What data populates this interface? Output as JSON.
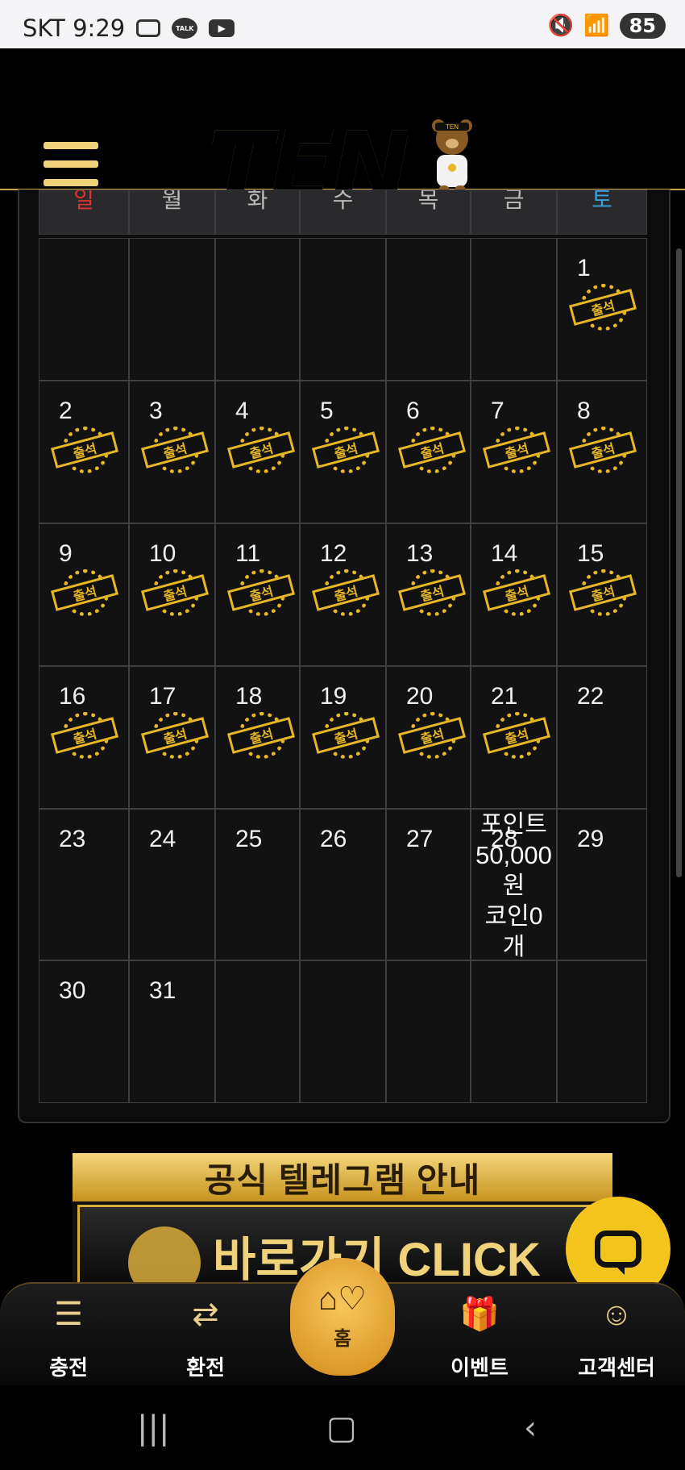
{
  "status_bar": {
    "carrier_time": "SKT 9:29",
    "battery": "85"
  },
  "header": {
    "logo_text": "TEN",
    "bear_badge": "TEN"
  },
  "calendar": {
    "weekdays": [
      "일",
      "월",
      "화",
      "수",
      "목",
      "금",
      "토"
    ],
    "stamp_label": "출석",
    "weeks": [
      [
        {
          "d": ""
        },
        {
          "d": ""
        },
        {
          "d": ""
        },
        {
          "d": ""
        },
        {
          "d": ""
        },
        {
          "d": ""
        },
        {
          "d": "1",
          "stamp": true
        }
      ],
      [
        {
          "d": "2",
          "stamp": true
        },
        {
          "d": "3",
          "stamp": true
        },
        {
          "d": "4",
          "stamp": true
        },
        {
          "d": "5",
          "stamp": true
        },
        {
          "d": "6",
          "stamp": true
        },
        {
          "d": "7",
          "stamp": true
        },
        {
          "d": "8",
          "stamp": true
        }
      ],
      [
        {
          "d": "9",
          "stamp": true
        },
        {
          "d": "10",
          "stamp": true
        },
        {
          "d": "11",
          "stamp": true
        },
        {
          "d": "12",
          "stamp": true
        },
        {
          "d": "13",
          "stamp": true
        },
        {
          "d": "14",
          "stamp": true
        },
        {
          "d": "15",
          "stamp": true
        }
      ],
      [
        {
          "d": "16",
          "stamp": true
        },
        {
          "d": "17",
          "stamp": true
        },
        {
          "d": "18",
          "stamp": true
        },
        {
          "d": "19",
          "stamp": true
        },
        {
          "d": "20",
          "stamp": true
        },
        {
          "d": "21",
          "stamp": true
        },
        {
          "d": "22"
        }
      ],
      [
        {
          "d": "23"
        },
        {
          "d": "24"
        },
        {
          "d": "25"
        },
        {
          "d": "26"
        },
        {
          "d": "27"
        },
        {
          "d": "28",
          "reward": true
        },
        {
          "d": "29"
        }
      ],
      [
        {
          "d": "30"
        },
        {
          "d": "31"
        },
        {
          "d": ""
        },
        {
          "d": ""
        },
        {
          "d": ""
        },
        {
          "d": ""
        },
        {
          "d": ""
        }
      ]
    ],
    "reward": {
      "line1": "포인트",
      "line2": "50,000",
      "line3": "원",
      "line4": "코인0",
      "line5": "개"
    }
  },
  "banner": {
    "title": "공식 텔레그램 안내",
    "cta": "바로가기 CLICK"
  },
  "bottom_nav": {
    "charge": "충전",
    "exchange": "환전",
    "home": "홈",
    "event": "이벤트",
    "support": "고객센터"
  },
  "colors": {
    "gold": "#e7b726",
    "sunday": "#e0312d",
    "saturday": "#3aa0e0"
  }
}
